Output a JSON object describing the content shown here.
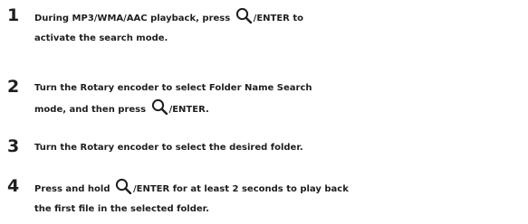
{
  "steps": [
    {
      "number": "1",
      "line1_a": "During MP3/WMA/AAC playback, press ",
      "line1_icon": "search-icon",
      "line1_b": "/ENTER",
      "line1_c": " to",
      "line2": "activate the search mode."
    },
    {
      "number": "2",
      "line1_a": "Turn the ",
      "line1_b": "Rotary encoder",
      "line1_c": " to select Folder Name Search",
      "line2_a": "mode, and then press ",
      "line2_icon": "search-icon",
      "line2_b": "/ENTER",
      "line2_c": "."
    },
    {
      "number": "3",
      "line1_a": "Turn the ",
      "line1_b": "Rotary encoder",
      "line1_c": " to select the desired folder."
    },
    {
      "number": "4",
      "line1_a": "Press and hold ",
      "line1_icon": "search-icon",
      "line1_b": "/ENTER",
      "line1_c": " for at least 2 seconds to play back",
      "line2": "the first file in the selected folder."
    }
  ]
}
